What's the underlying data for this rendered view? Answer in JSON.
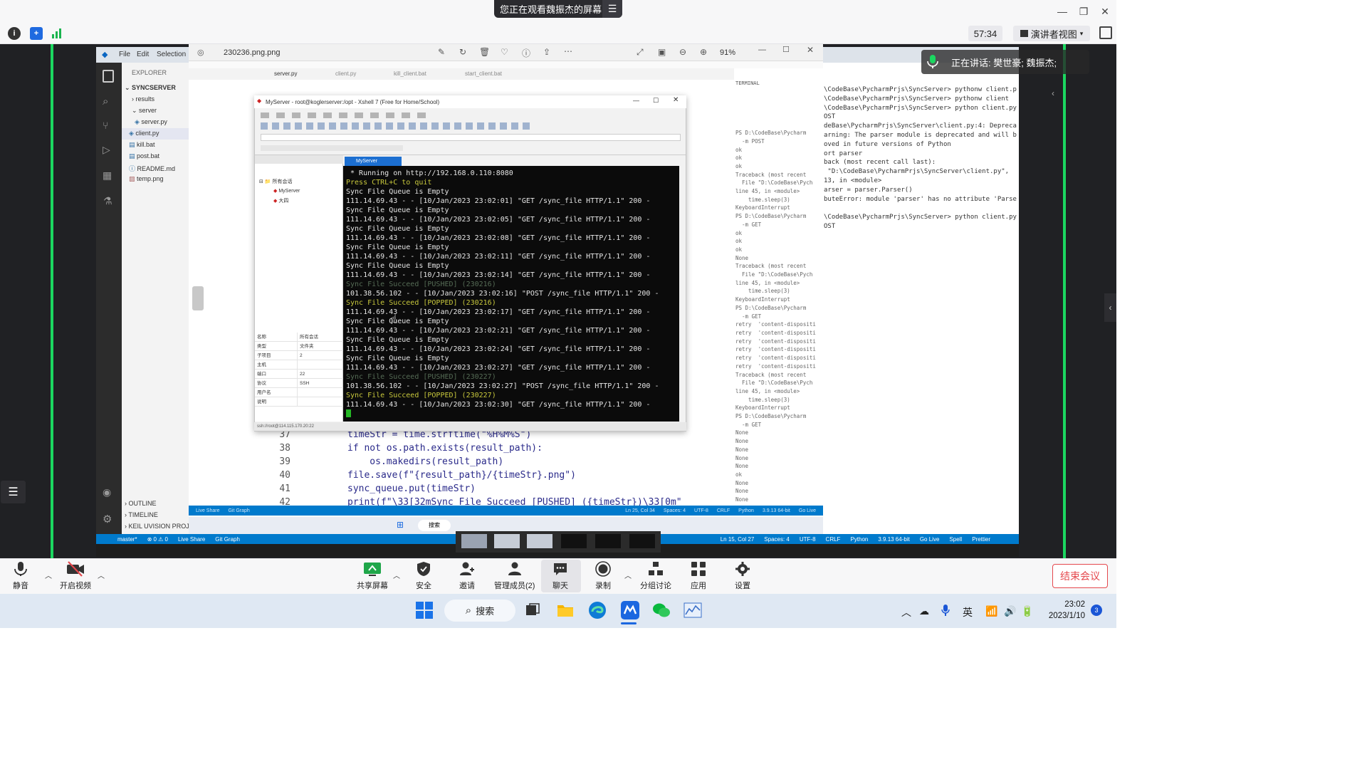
{
  "meeting": {
    "sharing_banner": "您正在观看魏振杰的屏幕",
    "timer": "57:34",
    "presenter_view": "演讲者视图",
    "speaking_label": "正在讲话: 樊世豪; 魏振杰;",
    "end_meeting": "结束会议",
    "accent_color": "#1bd760",
    "bottom_bar": {
      "mute": "静音",
      "video": "开启视频",
      "share": "共享屏幕",
      "security": "安全",
      "invite": "邀请",
      "participants": "管理成员(2)",
      "chat": "聊天",
      "record": "录制",
      "breakout": "分组讨论",
      "apps": "应用",
      "settings": "设置"
    }
  },
  "viewer": {
    "filename": "230236.png.png",
    "zoom": "91%"
  },
  "vscode": {
    "menu": [
      "File",
      "Edit",
      "Selection"
    ],
    "explorer_title": "EXPLORER",
    "project": "SYNCSERVER",
    "files": [
      "results",
      "server",
      "server.py",
      "client.py",
      "kill.bat",
      "post.bat",
      "README.md",
      "temp.png"
    ],
    "outline": "OUTLINE",
    "timeline": "TIMELINE",
    "keil": "KEIL UVISION PROJE",
    "status_left": [
      "master*",
      "⊗ 0 ⚠ 0",
      "Live Share",
      "Git Graph"
    ],
    "status_right": [
      "Ln 15, Col 27",
      "Spaces: 4",
      "UTF-8",
      "CRLF",
      "Python",
      "3.9.13 64-bit",
      "Go Live",
      "Spell",
      "Prettier"
    ],
    "terminal_lines": [
      "\\CodeBase\\PycharmPrjs\\SyncServer> pythonw client.p",
      "\\CodeBase\\PycharmPrjs\\SyncServer> pythonw client",
      "\\CodeBase\\PycharmPrjs\\SyncServer> python client.py",
      "OST",
      "deBase\\PycharmPrjs\\SyncServer\\client.py:4: Depreca",
      "arning: The parser module is deprecated and will b",
      "oved in future versions of Python",
      "ort parser",
      "back (most recent call last):",
      " \"D:\\CodeBase\\PycharmPrjs\\SyncServer\\client.py\",",
      "13, in <module>",
      "arser = parser.Parser()",
      "buteError: module 'parser' has no attribute 'Parse",
      "",
      "\\CodeBase\\PycharmPrjs\\SyncServer> python client.py",
      "OST"
    ]
  },
  "editor": {
    "tabs": [
      "server.py",
      "client.py",
      "kill_client.bat",
      "start_client.bat"
    ],
    "code": [
      {
        "num": "37",
        "text": "timeStr = time.strftime(\"%H%M%S\")"
      },
      {
        "num": "38",
        "text": "if not os.path.exists(result_path):"
      },
      {
        "num": "39",
        "text": "    os.makedirs(result_path)"
      },
      {
        "num": "40",
        "text": "file.save(f\"{result_path}/{timeStr}.png\")"
      },
      {
        "num": "41",
        "text": "sync_queue.put(timeStr)"
      },
      {
        "num": "42",
        "text": "print(f\"\\33[32mSync File Succeed [PUSHED] ({timeStr})\\33[0m\""
      }
    ],
    "terminal_label": "TERMINAL",
    "mini_terminal": [
      "PS D:\\CodeBase\\Pycharm",
      "  -m POST",
      "ok",
      "ok",
      "ok",
      "Traceback (most recent",
      "  File \"D:\\CodeBase\\Pych",
      "line 45, in <module>",
      "    time.sleep(3)",
      "KeyboardInterrupt",
      "PS D:\\CodeBase\\Pycharm",
      "  -m GET",
      "ok",
      "ok",
      "ok",
      "None",
      "Traceback (most recent",
      "  File \"D:\\CodeBase\\Pych",
      "line 45, in <module>",
      "    time.sleep(3)",
      "KeyboardInterrupt",
      "PS D:\\CodeBase\\Pycharm",
      "  -m GET",
      "retry  'content-dispositi",
      "retry  'content-dispositi",
      "retry  'content-dispositi",
      "retry  'content-dispositi",
      "retry  'content-dispositi",
      "retry  'content-dispositi",
      "Traceback (most recent",
      "  File \"D:\\CodeBase\\Pych",
      "line 45, in <module>",
      "    time.sleep(3)",
      "KeyboardInterrupt",
      "PS D:\\CodeBase\\Pycharm",
      "  -m GET",
      "None",
      "None",
      "None",
      "None",
      "None",
      "ok",
      "None",
      "None",
      "None",
      "ok"
    ],
    "status": [
      "Live Share",
      "Git Graph",
      "Ln 25, Col 34",
      "Spaces: 4",
      "UTF-8",
      "CRLF",
      "Python",
      "3.9.13 64-bit",
      "Go Live"
    ]
  },
  "xshell": {
    "title": "MyServer - root@koglerserver:/opt - Xshell 7 (Free for Home/School)",
    "tab": "MyServer",
    "session_tree": [
      "所有会话",
      "MyServer",
      "大四"
    ],
    "props": [
      [
        "名称",
        "所有会话"
      ],
      [
        "类型",
        "文件夹"
      ],
      [
        "子项目",
        "2"
      ],
      [
        "主机",
        ""
      ],
      [
        "端口",
        "22"
      ],
      [
        "协议",
        "SSH"
      ],
      [
        "用户名",
        ""
      ],
      [
        "说明",
        ""
      ]
    ],
    "status": "ssh://root@114.115.170.20:22",
    "terminal": [
      {
        "c": "white",
        "t": " * Running on http://192.168.0.110:8080"
      },
      {
        "c": "yellow",
        "t": "Press CTRL+C to quit"
      },
      {
        "c": "white",
        "t": "Sync File Queue is Empty"
      },
      {
        "c": "white",
        "t": "111.14.69.43 - - [10/Jan/2023 23:02:01] \"GET /sync_file HTTP/1.1\" 200 -"
      },
      {
        "c": "white",
        "t": "Sync File Queue is Empty"
      },
      {
        "c": "white",
        "t": "111.14.69.43 - - [10/Jan/2023 23:02:05] \"GET /sync_file HTTP/1.1\" 200 -"
      },
      {
        "c": "white",
        "t": "Sync File Queue is Empty"
      },
      {
        "c": "white",
        "t": "111.14.69.43 - - [10/Jan/2023 23:02:08] \"GET /sync_file HTTP/1.1\" 200 -"
      },
      {
        "c": "white",
        "t": "Sync File Queue is Empty"
      },
      {
        "c": "white",
        "t": "111.14.69.43 - - [10/Jan/2023 23:02:11] \"GET /sync_file HTTP/1.1\" 200 -"
      },
      {
        "c": "white",
        "t": "Sync File Queue is Empty"
      },
      {
        "c": "white",
        "t": "111.14.69.43 - - [10/Jan/2023 23:02:14] \"GET /sync_file HTTP/1.1\" 200 -"
      },
      {
        "c": "dim",
        "t": "Sync File Succeed [PUSHED] (230216)"
      },
      {
        "c": "white",
        "t": "101.38.56.102 - - [10/Jan/2023 23:02:16] \"POST /sync_file HTTP/1.1\" 200 -"
      },
      {
        "c": "yellow",
        "t": "Sync File Succeed [POPPED] (230216)"
      },
      {
        "c": "white",
        "t": "111.14.69.43 - - [10/Jan/2023 23:02:17] \"GET /sync_file HTTP/1.1\" 200 -"
      },
      {
        "c": "white",
        "t": "Sync File Queue is Empty"
      },
      {
        "c": "white",
        "t": "111.14.69.43 - - [10/Jan/2023 23:02:21] \"GET /sync_file HTTP/1.1\" 200 -"
      },
      {
        "c": "white",
        "t": "Sync File Queue is Empty"
      },
      {
        "c": "white",
        "t": "111.14.69.43 - - [10/Jan/2023 23:02:24] \"GET /sync_file HTTP/1.1\" 200 -"
      },
      {
        "c": "white",
        "t": "Sync File Queue is Empty"
      },
      {
        "c": "white",
        "t": "111.14.69.43 - - [10/Jan/2023 23:02:27] \"GET /sync_file HTTP/1.1\" 200 -"
      },
      {
        "c": "dim",
        "t": "Sync File Succeed [PUSHED] (230227)"
      },
      {
        "c": "white",
        "t": "101.38.56.102 - - [10/Jan/2023 23:02:27] \"POST /sync_file HTTP/1.1\" 200 -"
      },
      {
        "c": "yellow",
        "t": "Sync File Succeed [POPPED] (230227)"
      },
      {
        "c": "white",
        "t": "111.14.69.43 - - [10/Jan/2023 23:02:30] \"GET /sync_file HTTP/1.1\" 200 -"
      }
    ]
  },
  "taskbar": {
    "search": "搜索",
    "ime": "英",
    "time": "23:02",
    "date": "2023/1/10",
    "notifications": "3"
  }
}
